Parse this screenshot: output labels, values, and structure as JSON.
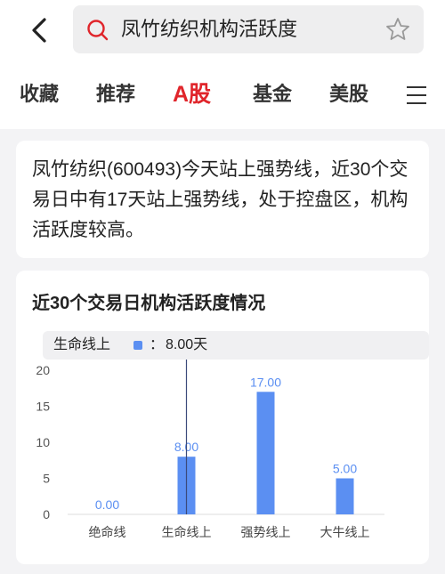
{
  "header": {
    "search_text": "凤竹纺织机构活跃度"
  },
  "tabs": [
    {
      "label": "收藏"
    },
    {
      "label": "推荐"
    },
    {
      "label": "A股"
    },
    {
      "label": "基金"
    },
    {
      "label": "美股"
    }
  ],
  "active_tab": "A股",
  "summary": {
    "text": "凤竹纺织(600493)今天站上强势线，近30个交易日中有17天站上强势线，处于控盘区，机构活跃度较高。"
  },
  "chart_data": {
    "type": "bar",
    "title": "近30个交易日机构活跃度情况",
    "categories": [
      "绝命线",
      "生命线上",
      "强势线上",
      "大牛线上"
    ],
    "values": [
      0,
      8,
      17,
      5
    ],
    "value_labels": [
      "0.00",
      "8.00",
      "17.00",
      "5.00"
    ],
    "ylim": [
      0,
      20
    ],
    "yticks": [
      "0",
      "5",
      "10",
      "15",
      "20"
    ],
    "bar_color": "#5b8ff2",
    "grid": false,
    "tooltip": {
      "label": "生命线上",
      "colon": "：",
      "value": "8.00天"
    },
    "highlighted_category": "生命线上"
  },
  "colors": {
    "accent": "#e0252b",
    "bar": "#5b8ff2"
  }
}
